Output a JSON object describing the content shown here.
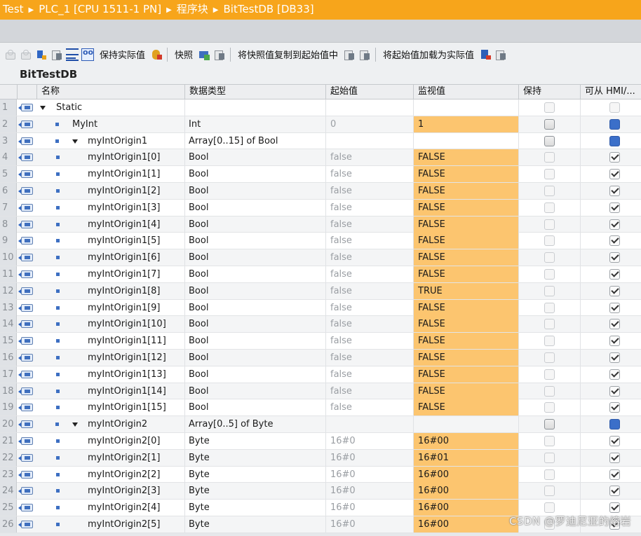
{
  "breadcrumb": [
    "Test",
    "PLC_1 [CPU 1511-1 PN]",
    "程序块",
    "BitTestDB [DB33]"
  ],
  "toolbar": {
    "keep_actual": "保持实际值",
    "snapshot": "快照",
    "copy_snapshot": "将快照值复制到起始值中",
    "load_start": "将起始值加载为实际值"
  },
  "db_title": "BitTestDB",
  "columns": {
    "name": "名称",
    "type": "数据类型",
    "start": "起始值",
    "monitor": "监视值",
    "keep": "保持",
    "hmi": "可从 HMI/..."
  },
  "rows": [
    {
      "num": "1",
      "indent": 0,
      "expand": true,
      "bullet": false,
      "name": "Static",
      "type": "",
      "start": "",
      "monitor": "",
      "keep": "dis",
      "hmi": "dis"
    },
    {
      "num": "2",
      "indent": 1,
      "expand": false,
      "bullet": true,
      "name": "MyInt",
      "type": "Int",
      "start": "0",
      "monitor": "1",
      "keep": "grayed",
      "hmi": "blue"
    },
    {
      "num": "3",
      "indent": 1,
      "expand": true,
      "bullet": true,
      "name": "myIntOrigin1",
      "type": "Array[0..15] of Bool",
      "start": "",
      "monitor": "",
      "keep": "grayed",
      "hmi": "blue"
    },
    {
      "num": "4",
      "indent": 2,
      "expand": false,
      "bullet": true,
      "name": "myIntOrigin1[0]",
      "type": "Bool",
      "start": "false",
      "monitor": "FALSE",
      "keep": "dis",
      "hmi": "on"
    },
    {
      "num": "5",
      "indent": 2,
      "expand": false,
      "bullet": true,
      "name": "myIntOrigin1[1]",
      "type": "Bool",
      "start": "false",
      "monitor": "FALSE",
      "keep": "dis",
      "hmi": "on"
    },
    {
      "num": "6",
      "indent": 2,
      "expand": false,
      "bullet": true,
      "name": "myIntOrigin1[2]",
      "type": "Bool",
      "start": "false",
      "monitor": "FALSE",
      "keep": "dis",
      "hmi": "on"
    },
    {
      "num": "7",
      "indent": 2,
      "expand": false,
      "bullet": true,
      "name": "myIntOrigin1[3]",
      "type": "Bool",
      "start": "false",
      "monitor": "FALSE",
      "keep": "dis",
      "hmi": "on"
    },
    {
      "num": "8",
      "indent": 2,
      "expand": false,
      "bullet": true,
      "name": "myIntOrigin1[4]",
      "type": "Bool",
      "start": "false",
      "monitor": "FALSE",
      "keep": "dis",
      "hmi": "on"
    },
    {
      "num": "9",
      "indent": 2,
      "expand": false,
      "bullet": true,
      "name": "myIntOrigin1[5]",
      "type": "Bool",
      "start": "false",
      "monitor": "FALSE",
      "keep": "dis",
      "hmi": "on"
    },
    {
      "num": "10",
      "indent": 2,
      "expand": false,
      "bullet": true,
      "name": "myIntOrigin1[6]",
      "type": "Bool",
      "start": "false",
      "monitor": "FALSE",
      "keep": "dis",
      "hmi": "on"
    },
    {
      "num": "11",
      "indent": 2,
      "expand": false,
      "bullet": true,
      "name": "myIntOrigin1[7]",
      "type": "Bool",
      "start": "false",
      "monitor": "FALSE",
      "keep": "dis",
      "hmi": "on"
    },
    {
      "num": "12",
      "indent": 2,
      "expand": false,
      "bullet": true,
      "name": "myIntOrigin1[8]",
      "type": "Bool",
      "start": "false",
      "monitor": "TRUE",
      "keep": "dis",
      "hmi": "on"
    },
    {
      "num": "13",
      "indent": 2,
      "expand": false,
      "bullet": true,
      "name": "myIntOrigin1[9]",
      "type": "Bool",
      "start": "false",
      "monitor": "FALSE",
      "keep": "dis",
      "hmi": "on"
    },
    {
      "num": "14",
      "indent": 2,
      "expand": false,
      "bullet": true,
      "name": "myIntOrigin1[10]",
      "type": "Bool",
      "start": "false",
      "monitor": "FALSE",
      "keep": "dis",
      "hmi": "on"
    },
    {
      "num": "15",
      "indent": 2,
      "expand": false,
      "bullet": true,
      "name": "myIntOrigin1[11]",
      "type": "Bool",
      "start": "false",
      "monitor": "FALSE",
      "keep": "dis",
      "hmi": "on"
    },
    {
      "num": "16",
      "indent": 2,
      "expand": false,
      "bullet": true,
      "name": "myIntOrigin1[12]",
      "type": "Bool",
      "start": "false",
      "monitor": "FALSE",
      "keep": "dis",
      "hmi": "on"
    },
    {
      "num": "17",
      "indent": 2,
      "expand": false,
      "bullet": true,
      "name": "myIntOrigin1[13]",
      "type": "Bool",
      "start": "false",
      "monitor": "FALSE",
      "keep": "dis",
      "hmi": "on"
    },
    {
      "num": "18",
      "indent": 2,
      "expand": false,
      "bullet": true,
      "name": "myIntOrigin1[14]",
      "type": "Bool",
      "start": "false",
      "monitor": "FALSE",
      "keep": "dis",
      "hmi": "on"
    },
    {
      "num": "19",
      "indent": 2,
      "expand": false,
      "bullet": true,
      "name": "myIntOrigin1[15]",
      "type": "Bool",
      "start": "false",
      "monitor": "FALSE",
      "keep": "dis",
      "hmi": "on"
    },
    {
      "num": "20",
      "indent": 1,
      "expand": true,
      "bullet": true,
      "name": "myIntOrigin2",
      "type": "Array[0..5] of Byte",
      "start": "",
      "monitor": "",
      "keep": "grayed",
      "hmi": "blue"
    },
    {
      "num": "21",
      "indent": 2,
      "expand": false,
      "bullet": true,
      "name": "myIntOrigin2[0]",
      "type": "Byte",
      "start": "16#0",
      "monitor": "16#00",
      "keep": "dis",
      "hmi": "on"
    },
    {
      "num": "22",
      "indent": 2,
      "expand": false,
      "bullet": true,
      "name": "myIntOrigin2[1]",
      "type": "Byte",
      "start": "16#0",
      "monitor": "16#01",
      "keep": "dis",
      "hmi": "on"
    },
    {
      "num": "23",
      "indent": 2,
      "expand": false,
      "bullet": true,
      "name": "myIntOrigin2[2]",
      "type": "Byte",
      "start": "16#0",
      "monitor": "16#00",
      "keep": "dis",
      "hmi": "on"
    },
    {
      "num": "24",
      "indent": 2,
      "expand": false,
      "bullet": true,
      "name": "myIntOrigin2[3]",
      "type": "Byte",
      "start": "16#0",
      "monitor": "16#00",
      "keep": "dis",
      "hmi": "on"
    },
    {
      "num": "25",
      "indent": 2,
      "expand": false,
      "bullet": true,
      "name": "myIntOrigin2[4]",
      "type": "Byte",
      "start": "16#0",
      "monitor": "16#00",
      "keep": "dis",
      "hmi": "on"
    },
    {
      "num": "26",
      "indent": 2,
      "expand": false,
      "bullet": true,
      "name": "myIntOrigin2[5]",
      "type": "Byte",
      "start": "16#0",
      "monitor": "16#00",
      "keep": "dis",
      "hmi": "on"
    }
  ],
  "watermark": "CSDN @罗迪尼亚的熔岩",
  "colors": {
    "title_bar": "#f7a51b",
    "monitor_highlight": "#fcc56f",
    "icon_blue": "#2f66c4"
  }
}
